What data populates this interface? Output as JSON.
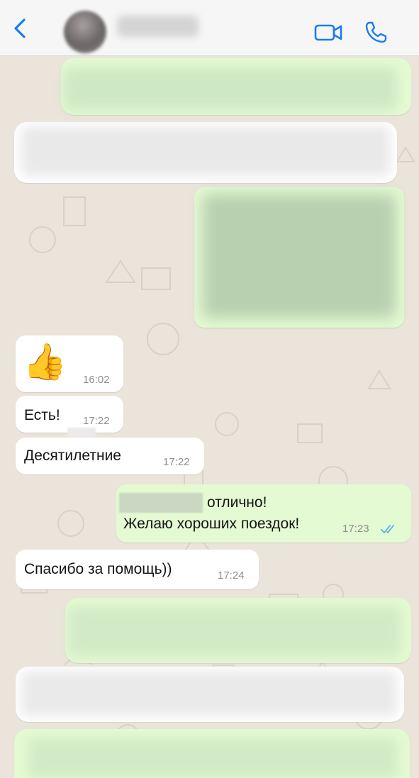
{
  "header": {
    "back_icon": "chevron-left-icon",
    "video_icon": "video-call-icon",
    "phone_icon": "phone-call-icon",
    "accent": "#1a7cf0"
  },
  "messages": [
    {
      "direction": "incoming",
      "emoji": "👍",
      "time": "16:02"
    },
    {
      "direction": "incoming",
      "text": "Есть!",
      "time": "17:22"
    },
    {
      "direction": "incoming",
      "text": "Десятилетние",
      "time": "17:22"
    },
    {
      "direction": "outgoing",
      "line1": "отлично!",
      "line2": "Желаю хороших поездок!",
      "time": "17:23",
      "status": "read"
    },
    {
      "direction": "incoming",
      "text": "Спасибо за помощь))",
      "time": "17:24"
    }
  ],
  "colors": {
    "incoming": "#ffffff",
    "outgoing": "#e4fad2",
    "read_ticks": "#4fb3ef"
  }
}
